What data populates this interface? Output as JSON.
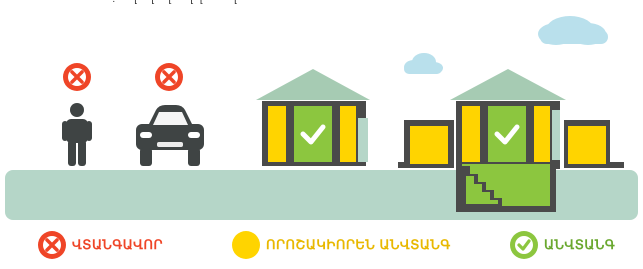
{
  "header": {
    "text": "– . – [ –[ –[ – [ [ – – [ – – – –"
  },
  "legend": [
    {
      "icon": "x-circle-icon",
      "label": "ՎՏԱՆԳԱՎՈՐ",
      "color": "#ef4527"
    },
    {
      "icon": "yellow-circle-icon",
      "label": "ՈՐՈՇԱԿԻՈՐԵՆ ԱՆՎՏԱՆԳ",
      "color": "#ffd400"
    },
    {
      "icon": "check-circle-icon",
      "label": "ԱՆՎՏԱՆԳ",
      "color": "#8cc63f"
    }
  ],
  "colors": {
    "ground": "#b5d6c8",
    "roof": "#a6cbb3",
    "wall": "#4a4a4a",
    "yellow": "#ffd400",
    "green": "#8cc63f",
    "cloud": "#b9e0ec",
    "danger": "#ef4527",
    "figure": "#3f4444"
  }
}
